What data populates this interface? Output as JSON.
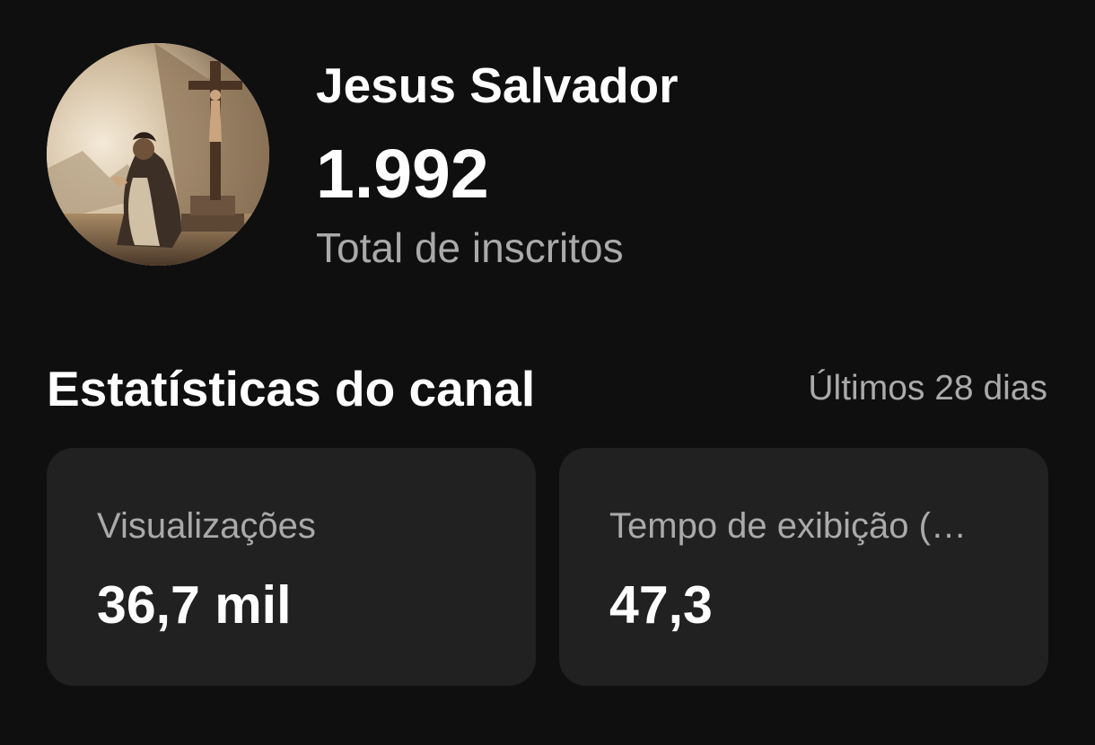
{
  "channel": {
    "name": "Jesus Salvador",
    "subscriber_count": "1.992",
    "subscriber_label": "Total de inscritos"
  },
  "stats": {
    "title": "Estatísticas do canal",
    "period": "Últimos 28 dias",
    "cards": [
      {
        "label": "Visualizações",
        "value": "36,7 mil"
      },
      {
        "label": "Tempo de exibição (…",
        "value": "47,3"
      }
    ]
  },
  "icons": {
    "avatar": "channel-avatar-praying-figure-before-cross"
  },
  "colors": {
    "background": "#0f0f0f",
    "card": "#212121",
    "primary_text": "#ffffff",
    "secondary_text": "#aaaaaa"
  }
}
